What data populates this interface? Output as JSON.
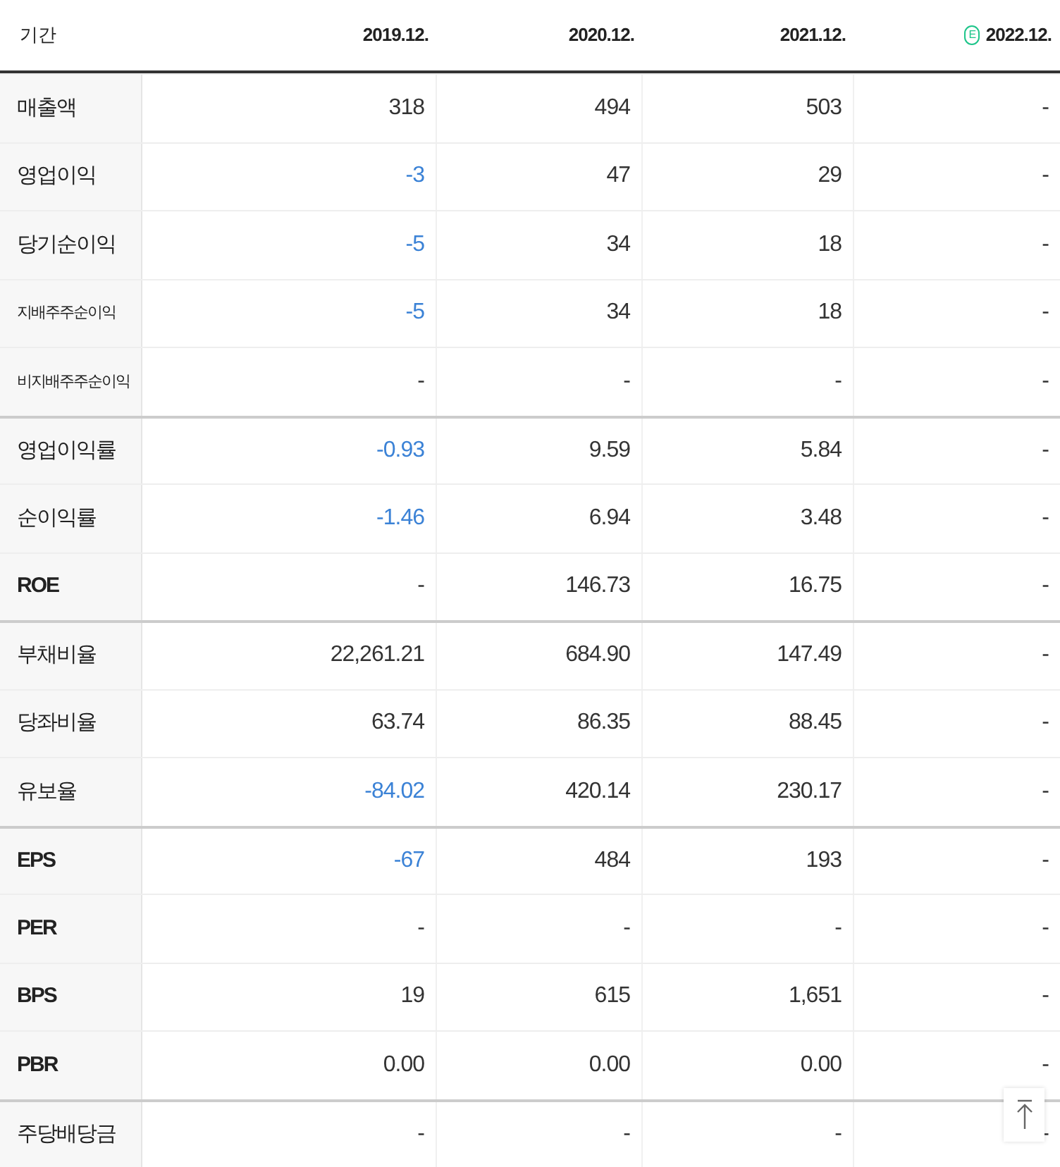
{
  "header": {
    "label": "기간",
    "periods": [
      {
        "text": "2019.12.",
        "estimate": false
      },
      {
        "text": "2020.12.",
        "estimate": false
      },
      {
        "text": "2021.12.",
        "estimate": false
      },
      {
        "text": "2022.12.",
        "estimate": true,
        "badge": "E"
      }
    ]
  },
  "rows": [
    {
      "label": "매출액",
      "group_start": false,
      "bold": false,
      "values": [
        {
          "text": "318",
          "negative": false
        },
        {
          "text": "494",
          "negative": false
        },
        {
          "text": "503",
          "negative": false
        },
        {
          "text": "-",
          "negative": false
        }
      ]
    },
    {
      "label": "영업이익",
      "group_start": false,
      "bold": false,
      "values": [
        {
          "text": "-3",
          "negative": true
        },
        {
          "text": "47",
          "negative": false
        },
        {
          "text": "29",
          "negative": false
        },
        {
          "text": "-",
          "negative": false
        }
      ]
    },
    {
      "label": "당기순이익",
      "group_start": false,
      "bold": false,
      "values": [
        {
          "text": "-5",
          "negative": true
        },
        {
          "text": "34",
          "negative": false
        },
        {
          "text": "18",
          "negative": false
        },
        {
          "text": "-",
          "negative": false
        }
      ]
    },
    {
      "label": "지배주주순이익",
      "group_start": false,
      "bold": false,
      "values": [
        {
          "text": "-5",
          "negative": true
        },
        {
          "text": "34",
          "negative": false
        },
        {
          "text": "18",
          "negative": false
        },
        {
          "text": "-",
          "negative": false
        }
      ]
    },
    {
      "label": "비지배주주순이익",
      "group_start": false,
      "bold": false,
      "values": [
        {
          "text": "-",
          "negative": false
        },
        {
          "text": "-",
          "negative": false
        },
        {
          "text": "-",
          "negative": false
        },
        {
          "text": "-",
          "negative": false
        }
      ]
    },
    {
      "label": "영업이익률",
      "group_start": true,
      "bold": false,
      "values": [
        {
          "text": "-0.93",
          "negative": true
        },
        {
          "text": "9.59",
          "negative": false
        },
        {
          "text": "5.84",
          "negative": false
        },
        {
          "text": "-",
          "negative": false
        }
      ]
    },
    {
      "label": "순이익률",
      "group_start": false,
      "bold": false,
      "values": [
        {
          "text": "-1.46",
          "negative": true
        },
        {
          "text": "6.94",
          "negative": false
        },
        {
          "text": "3.48",
          "negative": false
        },
        {
          "text": "-",
          "negative": false
        }
      ]
    },
    {
      "label": "ROE",
      "group_start": false,
      "bold": true,
      "values": [
        {
          "text": "-",
          "negative": false
        },
        {
          "text": "146.73",
          "negative": false
        },
        {
          "text": "16.75",
          "negative": false
        },
        {
          "text": "-",
          "negative": false
        }
      ]
    },
    {
      "label": "부채비율",
      "group_start": true,
      "bold": false,
      "values": [
        {
          "text": "22,261.21",
          "negative": false
        },
        {
          "text": "684.90",
          "negative": false
        },
        {
          "text": "147.49",
          "negative": false
        },
        {
          "text": "-",
          "negative": false
        }
      ]
    },
    {
      "label": "당좌비율",
      "group_start": false,
      "bold": false,
      "values": [
        {
          "text": "63.74",
          "negative": false
        },
        {
          "text": "86.35",
          "negative": false
        },
        {
          "text": "88.45",
          "negative": false
        },
        {
          "text": "-",
          "negative": false
        }
      ]
    },
    {
      "label": "유보율",
      "group_start": false,
      "bold": false,
      "values": [
        {
          "text": "-84.02",
          "negative": true
        },
        {
          "text": "420.14",
          "negative": false
        },
        {
          "text": "230.17",
          "negative": false
        },
        {
          "text": "-",
          "negative": false
        }
      ]
    },
    {
      "label": "EPS",
      "group_start": true,
      "bold": true,
      "values": [
        {
          "text": "-67",
          "negative": true
        },
        {
          "text": "484",
          "negative": false
        },
        {
          "text": "193",
          "negative": false
        },
        {
          "text": "-",
          "negative": false
        }
      ]
    },
    {
      "label": "PER",
      "group_start": false,
      "bold": true,
      "values": [
        {
          "text": "-",
          "negative": false
        },
        {
          "text": "-",
          "negative": false
        },
        {
          "text": "-",
          "negative": false
        },
        {
          "text": "-",
          "negative": false
        }
      ]
    },
    {
      "label": "BPS",
      "group_start": false,
      "bold": true,
      "values": [
        {
          "text": "19",
          "negative": false
        },
        {
          "text": "615",
          "negative": false
        },
        {
          "text": "1,651",
          "negative": false
        },
        {
          "text": "-",
          "negative": false
        }
      ]
    },
    {
      "label": "PBR",
      "group_start": false,
      "bold": true,
      "values": [
        {
          "text": "0.00",
          "negative": false
        },
        {
          "text": "0.00",
          "negative": false
        },
        {
          "text": "0.00",
          "negative": false
        },
        {
          "text": "-",
          "negative": false
        }
      ]
    },
    {
      "label": "주당배당금",
      "group_start": true,
      "bold": false,
      "values": [
        {
          "text": "-",
          "negative": false
        },
        {
          "text": "-",
          "negative": false
        },
        {
          "text": "-",
          "negative": false
        },
        {
          "text": "-",
          "negative": false
        }
      ]
    }
  ]
}
